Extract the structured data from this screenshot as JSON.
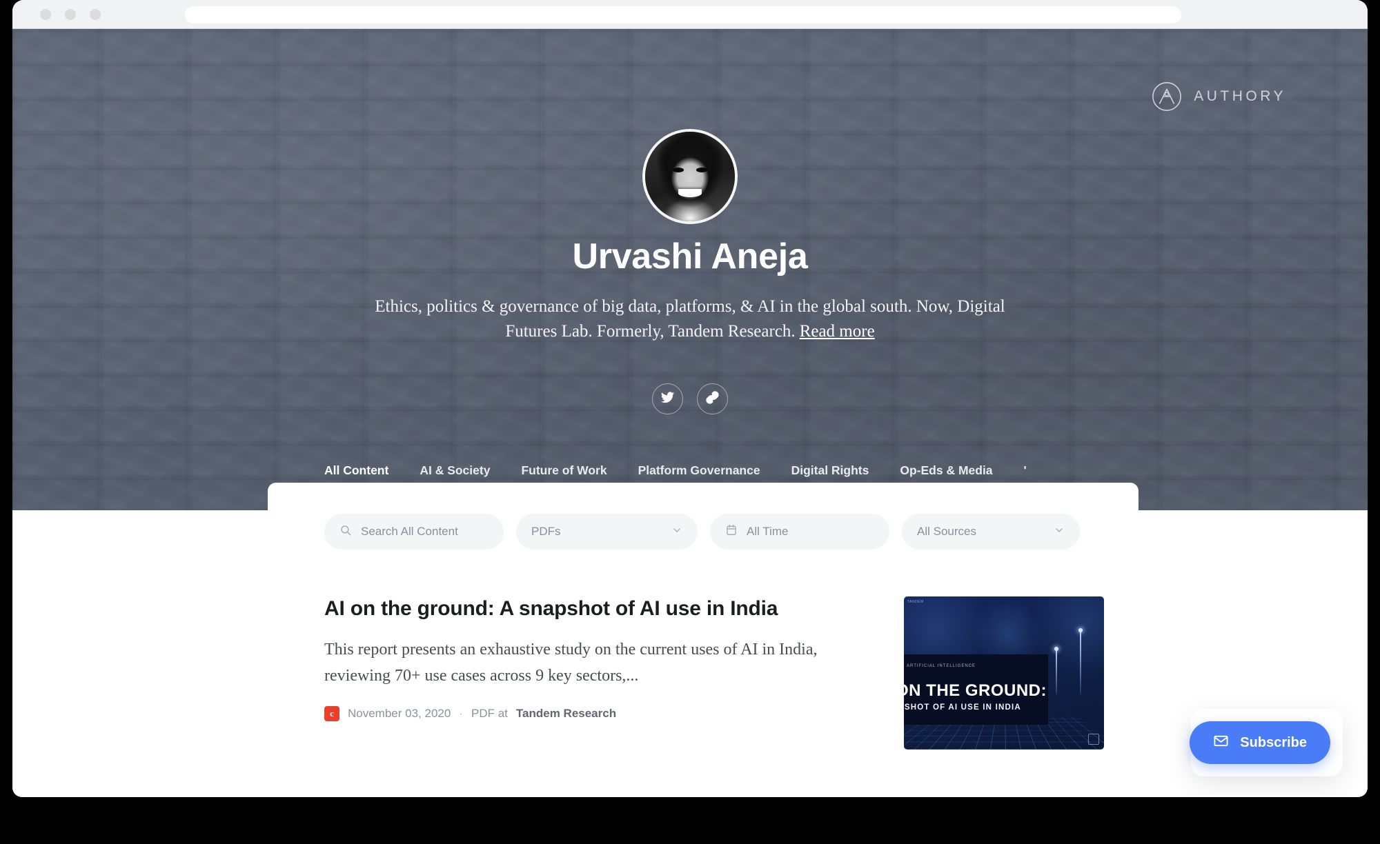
{
  "browser": {
    "address_value": "",
    "traffic_lights": [
      "close",
      "minimize",
      "maximize"
    ]
  },
  "brand": {
    "logo_word": "AUTHORY",
    "logo_icon": "authory-compass-a-icon"
  },
  "profile": {
    "name": "Urvashi Aneja",
    "bio": "Ethics, politics & governance of big data, platforms, & AI in the global south. Now, Digital Futures Lab. Formerly, Tandem Research.",
    "read_more": "Read more",
    "avatar_alt": "portrait-photo"
  },
  "social": [
    {
      "name": "twitter-icon",
      "label": "Twitter"
    },
    {
      "name": "link-icon",
      "label": "Website link"
    }
  ],
  "tabs": [
    {
      "label": "All Content",
      "active": true
    },
    {
      "label": "AI & Society",
      "active": false
    },
    {
      "label": "Future of Work",
      "active": false
    },
    {
      "label": "Platform Governance",
      "active": false
    },
    {
      "label": "Digital Rights",
      "active": false
    },
    {
      "label": "Op-Eds & Media",
      "active": false
    }
  ],
  "tab_overflow": "'",
  "filters": {
    "search_placeholder": "Search All Content",
    "search_value": "",
    "type_selected": "PDFs",
    "time_selected": "All Time",
    "sources_selected": "All Sources"
  },
  "articles": [
    {
      "title": "AI on the ground: A snapshot of AI use in India",
      "description": "This report presents an exhaustive study on the current uses of AI in India, reviewing 70+ use cases across 9 key sectors,...",
      "favicon_letter": "c",
      "date": "November 03, 2020",
      "separator": "·",
      "type_and_source_prefix": "PDF at",
      "source": "Tandem Research",
      "thumbnail": {
        "top_left_text": "TANDEM",
        "kicker": "ARTIFICIAL INTELLIGENCE",
        "heading": "ON THE GROUND:",
        "subheading": "PSHOT OF AI USE IN INDIA"
      }
    }
  ],
  "subscribe": {
    "label": "Subscribe",
    "icon": "envelope-icon"
  },
  "colors": {
    "hero_bg": "#5b6374",
    "accent_blue": "#4a7cf7",
    "favicon_red": "#e8402a",
    "card_bg": "#ffffff",
    "filter_pill": "#f4f5f7"
  }
}
